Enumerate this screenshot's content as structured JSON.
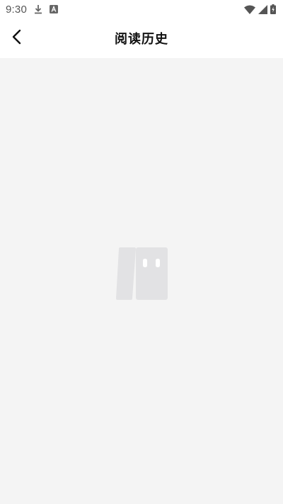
{
  "status_bar": {
    "time": "9:30",
    "icons": [
      "download-icon",
      "a-badge-icon",
      "wifi-icon",
      "signal-icon",
      "battery-icon"
    ]
  },
  "header": {
    "back_icon": "chevron-left-icon",
    "title": "阅读历史"
  },
  "empty_state": {
    "icon": "empty-books-icon"
  },
  "colors": {
    "background": "#f4f4f4",
    "header_background": "#ffffff",
    "title_text": "#111111",
    "illustration": "#e2e2e4"
  }
}
